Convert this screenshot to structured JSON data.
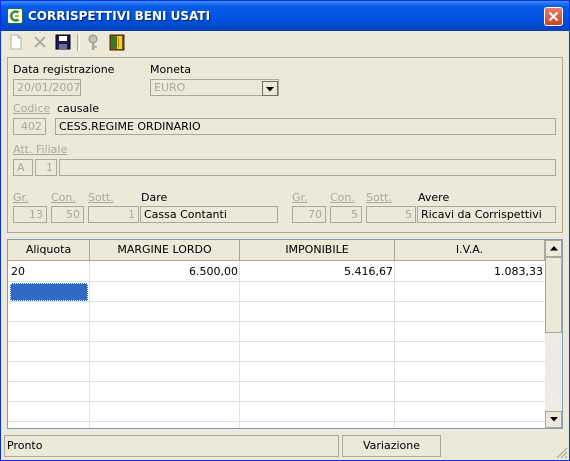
{
  "window": {
    "title": "CORRISPETTIVI BENI USATI",
    "close_label": "✕"
  },
  "toolbar": {
    "items": [
      "new-document-icon",
      "delete-icon",
      "save-icon",
      "key-icon",
      "exit-door-icon"
    ]
  },
  "header": {
    "data_registrazione": {
      "label": "Data registrazione",
      "value": "20/01/2007"
    },
    "moneta": {
      "label": "Moneta",
      "value": "EURO"
    },
    "codice": {
      "label": "Codice",
      "value": "402"
    },
    "causale": {
      "label": "causale",
      "value": "CESS.REGIME ORDINARIO"
    },
    "att_filiale": {
      "label": "Att. Filiale",
      "att": "A",
      "filiale": "1",
      "desc": ""
    },
    "dare": {
      "gr_label": "Gr.",
      "con_label": "Con.",
      "sott_label": "Sott.",
      "label": "Dare",
      "gr": "13",
      "con": "50",
      "sott": "1",
      "desc": "Cassa Contanti"
    },
    "avere": {
      "gr_label": "Gr.",
      "con_label": "Con.",
      "sott_label": "Sott.",
      "label": "Avere",
      "gr": "70",
      "con": "5",
      "sott": "5",
      "desc": "Ricavi da Corrispettivi"
    }
  },
  "grid": {
    "columns": [
      "Aliquota",
      "MARGINE LORDO",
      "IMPONIBILE",
      "I.V.A."
    ],
    "rows": [
      {
        "aliquota": "20",
        "margine_lordo": "6.500,00",
        "imponibile": "5.416,67",
        "iva": "1.083,33"
      }
    ]
  },
  "status": {
    "left": "Pronto",
    "mode": "Variazione"
  },
  "colors": {
    "title_bar": "#0054e3",
    "face": "#ece9d8",
    "selection": "#316ac5",
    "close_button": "#d4542c"
  }
}
